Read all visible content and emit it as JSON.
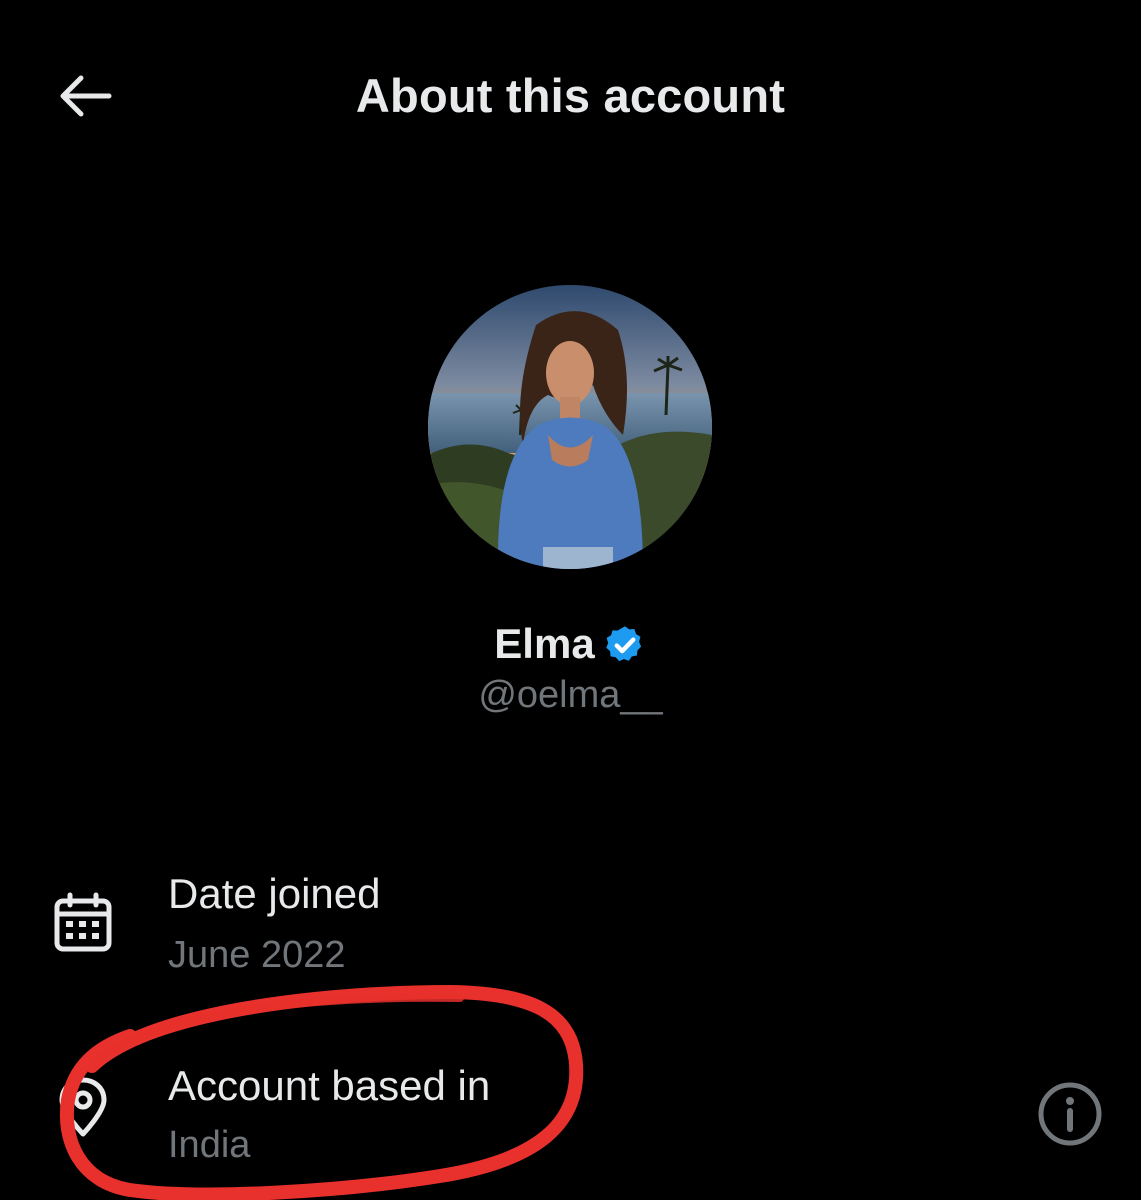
{
  "header": {
    "title": "About this account",
    "back_icon": "arrow-left-icon"
  },
  "profile": {
    "avatar_icon": "profile-photo",
    "display_name": "Elma",
    "verified_icon": "verified-badge-icon",
    "verified_color": "#1d9bf0",
    "handle": "@oelma__"
  },
  "details": {
    "date_joined": {
      "icon": "calendar-icon",
      "label": "Date joined",
      "value": "June 2022"
    },
    "account_based_in": {
      "icon": "location-pin-icon",
      "label": "Account based in",
      "value": "India",
      "info_icon": "info-icon"
    }
  },
  "annotation": {
    "type": "hand-drawn-circle",
    "color": "#e8302c"
  },
  "colors": {
    "background": "#000000",
    "primary_text": "#e7e9ea",
    "secondary_text": "#71767b"
  }
}
